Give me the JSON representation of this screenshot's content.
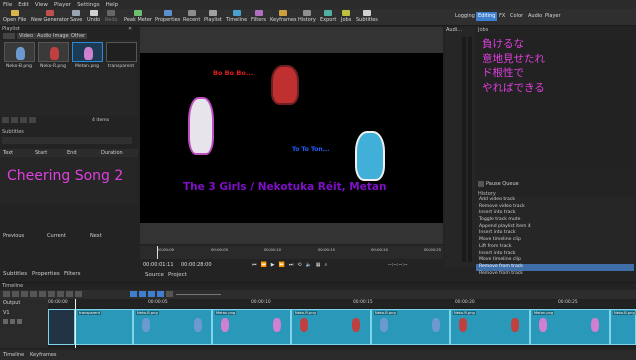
{
  "menu": [
    "File",
    "Edit",
    "View",
    "Player",
    "Settings",
    "Help"
  ],
  "toolbar": {
    "buttons": [
      "Open File",
      "New Generator",
      "Save",
      "Undo",
      "Redo",
      "Peak Meter",
      "Properties",
      "Recent",
      "Playlist",
      "Timeline",
      "Filters",
      "Keyframes",
      "History",
      "Export",
      "Jobs",
      "Subtitles"
    ],
    "layouts": [
      "Logging",
      "Editing",
      "FX",
      "Color",
      "Audio",
      "Player"
    ],
    "active_layout": "Editing"
  },
  "playlist": {
    "title": "Playlist",
    "filter_tabs": [
      "Video",
      "Audio",
      "Image",
      "Other"
    ],
    "items": [
      "Neko-B.png",
      "Neko-R.png",
      "Metan.png",
      "transparent"
    ],
    "count": "4 items"
  },
  "subtitles": {
    "title": "Subtitles",
    "columns": [
      "Text",
      "Start",
      "End",
      "Duration"
    ],
    "preview_text": "Cheering Song 2",
    "nav": [
      "Previous",
      "Current",
      "Next"
    ]
  },
  "left_tabs": [
    "Subtitles",
    "Properties",
    "Filters"
  ],
  "viewer": {
    "text_bo": "Bo Bo Bo...",
    "text_to": "To To Ton...",
    "caption": "The 3 Girls / Nekotuka Réit, Metan",
    "timecode": "00:00:01:11",
    "duration": "00:00:28:00",
    "ruler": [
      "00:00:00",
      "00:00:05",
      "00:00:10",
      "00:00:15",
      "00:00:20",
      "00:00:25"
    ],
    "tabs": [
      "Source",
      "Project"
    ],
    "out_time": "--:--:--:--"
  },
  "audio_title": "Audi…",
  "jobs": {
    "title": "Jobs",
    "lyrics": [
      "負けるな",
      "意地見せたれ",
      "ド根性で",
      "やればできる"
    ],
    "pause_queue": "Pause Queue"
  },
  "history": {
    "title": "History",
    "items": [
      "Add video track",
      "Remove video track",
      "Insert into track",
      "Toggle track mute",
      "Append playlist item 4",
      "Insert into track",
      "Move timeline clip",
      "Lift from track",
      "Insert into track",
      "Move timeline clip",
      "Remove from track",
      "Remove from track"
    ],
    "selected_index": 10
  },
  "timeline": {
    "title": "Timeline",
    "output_label": "Output",
    "track_label": "V1",
    "ruler": [
      "00:00:00",
      "00:00:05",
      "00:00:10",
      "00:00:15",
      "00:00:20",
      "00:00:25"
    ],
    "clips": [
      "transparent",
      "Neko-B.png",
      "Metan.png",
      "Neko-R.png",
      "Neko-B.png",
      "Neko-R.png",
      "Metan.png",
      "Neko-B.png"
    ]
  },
  "bottom_tabs": [
    "Timeline",
    "Keyframes"
  ],
  "colors": {
    "accent": "#3f7fd0",
    "clip": "#2a98b8",
    "viewer_bg": "#000000",
    "magenta_text": "#e040e0",
    "red_text": "#e02020",
    "blue_text": "#2060ff",
    "caption": "#8010c8"
  }
}
